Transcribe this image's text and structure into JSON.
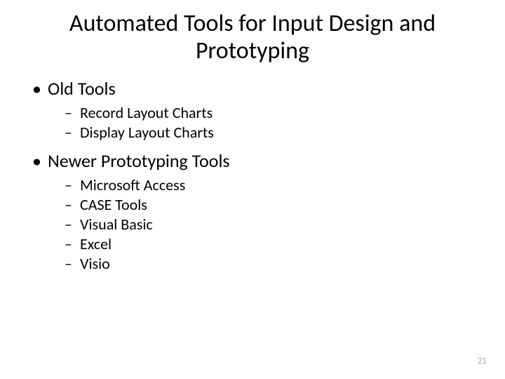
{
  "slide": {
    "title": "Automated Tools for Input Design and Prototyping",
    "page_number": "21",
    "bullets": [
      {
        "label": "Old Tools",
        "children": [
          "Record Layout Charts",
          "Display Layout Charts"
        ]
      },
      {
        "label": "Newer Prototyping Tools",
        "children": [
          "Microsoft Access",
          "CASE Tools",
          "Visual Basic",
          "Excel",
          "Visio"
        ]
      }
    ]
  }
}
